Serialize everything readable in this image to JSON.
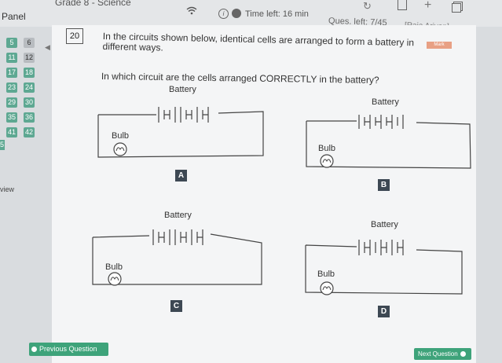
{
  "topbar": {
    "title": "Grade 8 - Science",
    "time_left": "Time left: 16 min",
    "ques_left": "Ques. left: 7/45",
    "user": "[Raja Ariyan]"
  },
  "panel": {
    "label": "Panel",
    "numbers": [
      "5",
      "6",
      "11",
      "12",
      "17",
      "18",
      "23",
      "24",
      "29",
      "30",
      "35",
      "36",
      "41",
      "42"
    ],
    "review_label": "view"
  },
  "question": {
    "number": "20",
    "mark_badge": "Mark",
    "text_line1": "In the circuits shown below, identical cells are arranged to form a battery in different ways.",
    "text_line2": "In which circuit are the cells arranged CORRECTLY in the battery?"
  },
  "circuits": {
    "battery_label": "Battery",
    "bulb_label": "Bulb",
    "options": [
      "A",
      "B",
      "C",
      "D"
    ]
  },
  "nav": {
    "prev": "Previous Question",
    "next": "Next Question"
  }
}
